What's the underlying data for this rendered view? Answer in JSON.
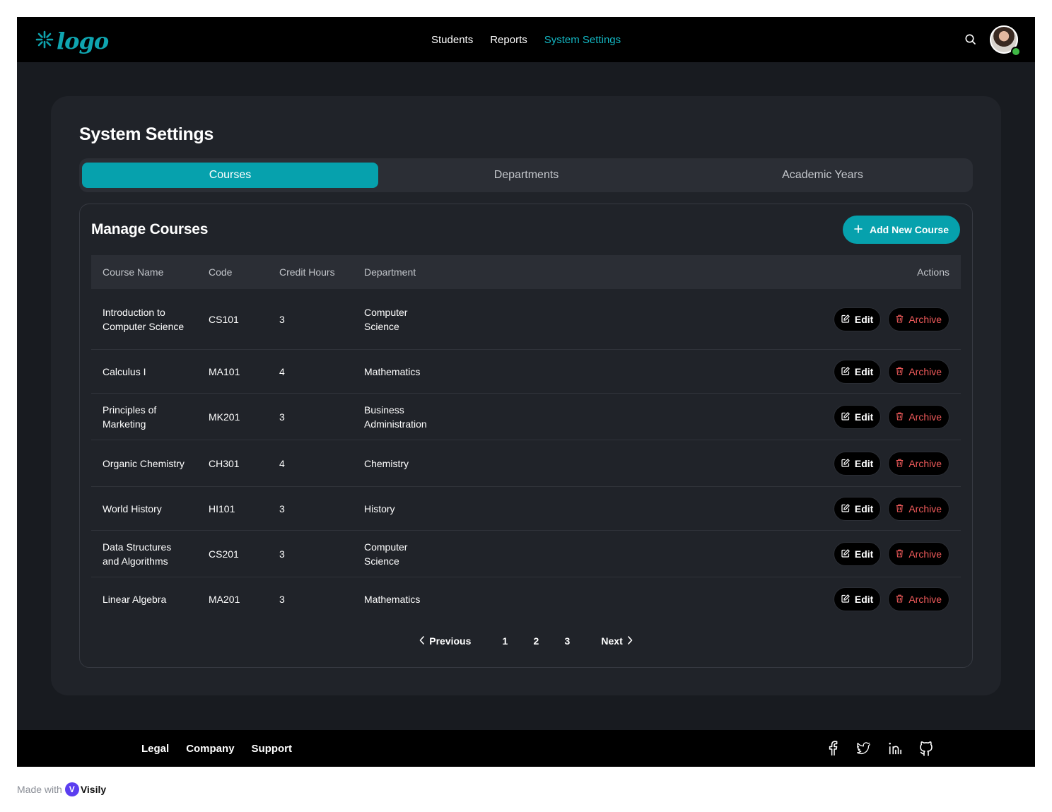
{
  "header": {
    "logo_text": "logo",
    "nav": [
      {
        "label": "Students"
      },
      {
        "label": "Reports"
      },
      {
        "label": "System Settings",
        "active": true
      }
    ],
    "accent_color": "#13b6c2"
  },
  "page": {
    "title": "System Settings",
    "tabs": [
      {
        "label": "Courses",
        "active": true
      },
      {
        "label": "Departments"
      },
      {
        "label": "Academic Years"
      }
    ]
  },
  "courses": {
    "title": "Manage Courses",
    "add_button": "Add New Course",
    "columns": {
      "name": "Course Name",
      "code": "Code",
      "credit": "Credit Hours",
      "department": "Department",
      "actions": "Actions"
    },
    "edit_label": "Edit",
    "archive_label": "Archive",
    "rows": [
      {
        "name": "Introduction to Computer Science",
        "code": "CS101",
        "credit": "3",
        "department": "Computer Science"
      },
      {
        "name": "Calculus I",
        "code": "MA101",
        "credit": "4",
        "department": "Mathematics"
      },
      {
        "name": "Principles of Marketing",
        "code": "MK201",
        "credit": "3",
        "department": "Business Administration"
      },
      {
        "name": "Organic Chemistry",
        "code": "CH301",
        "credit": "4",
        "department": "Chemistry"
      },
      {
        "name": "World History",
        "code": "HI101",
        "credit": "3",
        "department": "History"
      },
      {
        "name": "Data Structures and Algorithms",
        "code": "CS201",
        "credit": "3",
        "department": "Computer Science"
      },
      {
        "name": "Linear Algebra",
        "code": "MA201",
        "credit": "3",
        "department": "Mathematics"
      }
    ]
  },
  "pagination": {
    "previous": "Previous",
    "pages": [
      "1",
      "2",
      "3"
    ],
    "next": "Next"
  },
  "footer": {
    "links": [
      "Legal",
      "Company",
      "Support"
    ],
    "socials": [
      "facebook-icon",
      "twitter-icon",
      "linkedin-icon",
      "github-icon"
    ]
  },
  "badge": {
    "made_with": "Made with",
    "brand": "Visily"
  },
  "colors": {
    "primary": "#06a1ad",
    "danger": "#ef5a5a",
    "background": "#181b20",
    "card": "#202329"
  }
}
